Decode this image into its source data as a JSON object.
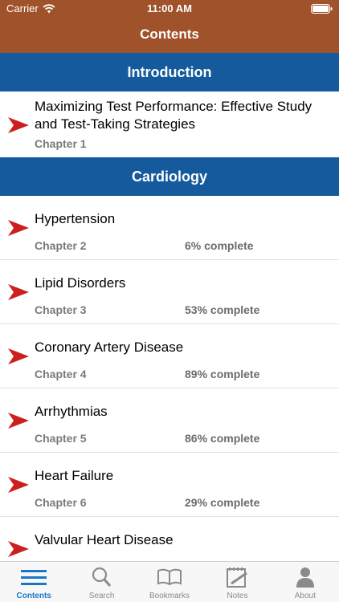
{
  "status": {
    "carrier": "Carrier",
    "time": "11:00 AM"
  },
  "nav": {
    "title": "Contents"
  },
  "colors": {
    "header": "#a0532a",
    "section": "#145a9c",
    "arrow": "#cc1f1f",
    "tab_active": "#1976c8"
  },
  "sections": [
    {
      "title": "Introduction",
      "chapters": [
        {
          "title": "Maximizing Test Performance: Effective Study and Test-Taking Strategies",
          "chapter": "Chapter 1",
          "progress": ""
        }
      ]
    },
    {
      "title": "Cardiology",
      "chapters": [
        {
          "title": "Hypertension",
          "chapter": "Chapter 2",
          "progress": "6% complete"
        },
        {
          "title": "Lipid Disorders",
          "chapter": "Chapter 3",
          "progress": "53% complete"
        },
        {
          "title": "Coronary Artery Disease",
          "chapter": "Chapter 4",
          "progress": "89% complete"
        },
        {
          "title": "Arrhythmias",
          "chapter": "Chapter 5",
          "progress": "86% complete"
        },
        {
          "title": "Heart Failure",
          "chapter": "Chapter 6",
          "progress": "29% complete"
        },
        {
          "title": "Valvular Heart Disease",
          "chapter": "",
          "progress": ""
        }
      ]
    }
  ],
  "tabs": [
    {
      "label": "Contents",
      "icon": "list-icon",
      "active": true
    },
    {
      "label": "Search",
      "icon": "search-icon",
      "active": false
    },
    {
      "label": "Bookmarks",
      "icon": "book-icon",
      "active": false
    },
    {
      "label": "Notes",
      "icon": "notepad-icon",
      "active": false
    },
    {
      "label": "About",
      "icon": "person-icon",
      "active": false
    }
  ]
}
